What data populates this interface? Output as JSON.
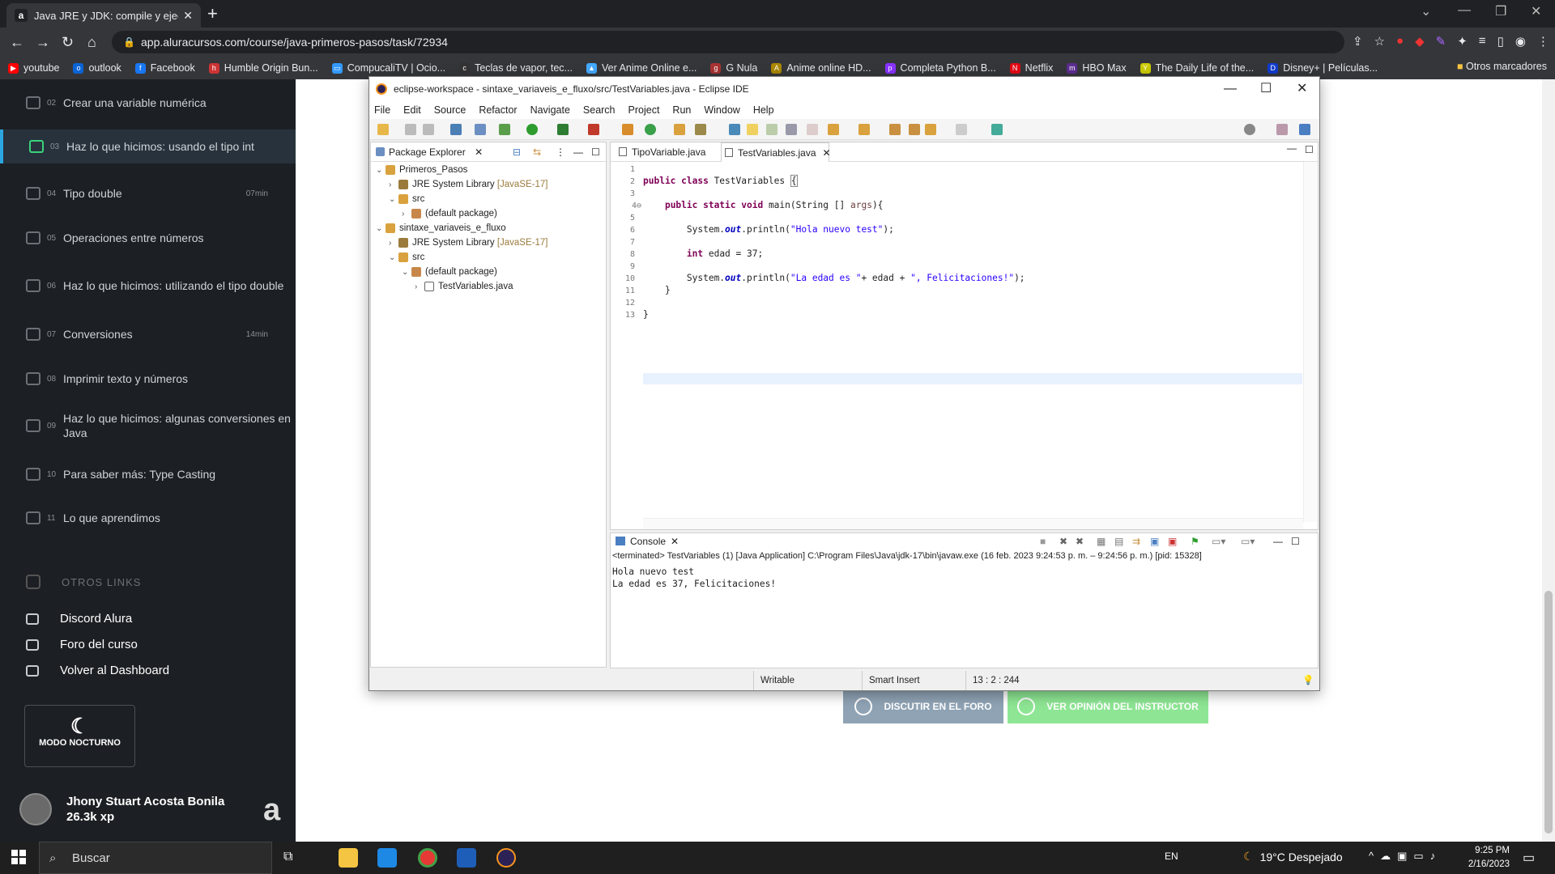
{
  "browser": {
    "tab_title": "Java JRE y JDK: compile y ejecute",
    "favicon_letter": "a",
    "url": "app.aluracursos.com/course/java-primeros-pasos/task/72934",
    "bookmarks": [
      "youtube",
      "outlook",
      "Facebook",
      "Humble Origin Bun...",
      "CompucaliTV | Ocio...",
      "Teclas de vapor, tec...",
      "Ver Anime Online e...",
      "G Nula",
      "Anime online HD...",
      "Completa Python B...",
      "Netflix",
      "HBO Max",
      "The Daily Life of the...",
      "Disney+ | Películas..."
    ],
    "other_bookmarks": "Otros marcadores"
  },
  "sidebar": {
    "items": [
      {
        "num": "02",
        "label": "Crear una variable numérica",
        "duration": ""
      },
      {
        "num": "03",
        "label": "Haz lo que hicimos: usando el tipo int",
        "duration": ""
      },
      {
        "num": "04",
        "label": "Tipo double",
        "duration": "07min"
      },
      {
        "num": "05",
        "label": "Operaciones entre números",
        "duration": ""
      },
      {
        "num": "06",
        "label": "Haz lo que hicimos: utilizando el tipo double",
        "duration": ""
      },
      {
        "num": "07",
        "label": "Conversiones",
        "duration": "14min"
      },
      {
        "num": "08",
        "label": "Imprimir texto y números",
        "duration": ""
      },
      {
        "num": "09",
        "label": "Haz lo que hicimos: algunas conversiones en Java",
        "duration": ""
      },
      {
        "num": "10",
        "label": "Para saber más: Type Casting",
        "duration": ""
      },
      {
        "num": "11",
        "label": "Lo que aprendimos",
        "duration": ""
      }
    ],
    "otros_links_title": "OTROS LINKS",
    "links": [
      "Discord Alura",
      "Foro del curso",
      "Volver al Dashboard"
    ],
    "night_mode": "MODO NOCTURNO",
    "user_name": "Jhony Stuart Acosta Bonila",
    "user_xp": "26.3k xp"
  },
  "page": {
    "btn_forum": "DISCUTIR EN EL FORO",
    "btn_opinion": "VER OPINIÓN DEL INSTRUCTOR"
  },
  "eclipse": {
    "title": "eclipse-workspace - sintaxe_variaveis_e_fluxo/src/TestVariables.java - Eclipse IDE",
    "menu": [
      "File",
      "Edit",
      "Source",
      "Refactor",
      "Navigate",
      "Search",
      "Project",
      "Run",
      "Window",
      "Help"
    ],
    "package_explorer": "Package Explorer",
    "tree": {
      "proj1": "Primeros_Pasos",
      "jre": "JRE System Library",
      "jre_ver": "[JavaSE-17]",
      "src": "src",
      "default_pkg": "(default package)",
      "proj2": "sintaxe_variaveis_e_fluxo",
      "file": "TestVariables.java"
    },
    "editor_tabs": [
      "TipoVariable.java",
      "TestVariables.java"
    ],
    "line_numbers": [
      "1",
      "2",
      "3",
      "4⊖",
      "5",
      "6",
      "7",
      "8",
      "9",
      "10",
      "11",
      "12",
      "13"
    ],
    "code": {
      "l2_kw": "public class",
      "l2_rest": " TestVariables ",
      "l2_brace": "{",
      "l4_kw": "public static void",
      "l4_a": " main(String [] ",
      "l4_p": "args",
      "l4_b": "){",
      "l6_a": "System.",
      "l6_out": "out",
      "l6_b": ".println(",
      "l6_s": "\"Hola nuevo test\"",
      "l6_c": ");",
      "l8_kw": "int",
      "l8_rest": " edad = 37;",
      "l10_a": "System.",
      "l10_out": "out",
      "l10_b": ".println(",
      "l10_s1": "\"La edad es \"",
      "l10_m": "+ edad + ",
      "l10_s2": "\", Felicitaciones!\"",
      "l10_c": ");",
      "l11": "}",
      "l13": "}"
    },
    "console_tab": "Console",
    "console_terminated": "<terminated> TestVariables (1) [Java Application] C:\\Program Files\\Java\\jdk-17\\bin\\javaw.exe  (16 feb. 2023 9:24:53 p. m. – 9:24:56 p. m.) [pid: 15328]",
    "console_out_1": "Hola nuevo test",
    "console_out_2": "La edad es 37, Felicitaciones!",
    "status_writable": "Writable",
    "status_insert": "Smart Insert",
    "status_pos": "13 : 2 : 244"
  },
  "taskbar": {
    "search": "Buscar",
    "lang": "EN",
    "weather": "19°C  Despejado",
    "time": "9:25 PM",
    "date": "2/16/2023"
  }
}
